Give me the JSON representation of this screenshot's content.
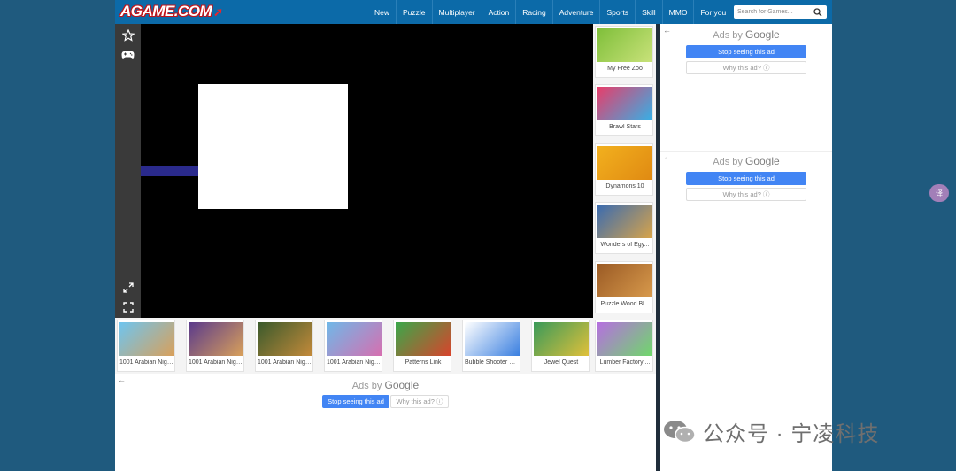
{
  "header": {
    "logo": "AGAME.COM",
    "nav": [
      "New",
      "Puzzle",
      "Multiplayer",
      "Action",
      "Racing",
      "Adventure",
      "Sports",
      "Skill",
      "MMO",
      "For you"
    ],
    "search_placeholder": "Search for Games..."
  },
  "side_games": [
    {
      "label": "My Free Zoo",
      "color1": "#7fbf3a",
      "color2": "#c9e27a"
    },
    {
      "label": "Brawl Stars",
      "color1": "#e83d6a",
      "color2": "#36b0e6"
    },
    {
      "label": "Dynamons 10",
      "color1": "#f2b01e",
      "color2": "#e08a12"
    },
    {
      "label": "Wonders of Egy...",
      "color1": "#3a6bb0",
      "color2": "#d8a44a"
    },
    {
      "label": "Puzzle Wood Bl...",
      "color1": "#9b5b25",
      "color2": "#d89a4c"
    },
    {
      "label": "Lumber Factory ...",
      "color1": "#b66fe0",
      "color2": "#6fd86a"
    }
  ],
  "bottom_games": [
    {
      "label": "1001 Arabian Night...",
      "color1": "#6fc5ef",
      "color2": "#d9a05a"
    },
    {
      "label": "1001 Arabian Night...",
      "color1": "#5a3a8c",
      "color2": "#d9a05a"
    },
    {
      "label": "1001 Arabian Night...",
      "color1": "#3a5a2c",
      "color2": "#c48a3a"
    },
    {
      "label": "1001 Arabian Night...",
      "color1": "#6fb8e8",
      "color2": "#d66fb0"
    },
    {
      "label": "Patterns Link",
      "color1": "#3aa84a",
      "color2": "#d8442c"
    },
    {
      "label": "Bubble Shooter Cl...",
      "color1": "#ffffff",
      "color2": "#3a7fe0"
    },
    {
      "label": "Jewel Quest",
      "color1": "#3a9a5a",
      "color2": "#e0c03a"
    },
    {
      "label": "Lumber Factory ...",
      "color1": "#b66fe0",
      "color2": "#6fd86a"
    }
  ],
  "ads": {
    "ads_by": "Ads by",
    "google": "Google",
    "stop": "Stop seeing this ad",
    "why": "Why this ad? ⓘ"
  },
  "translate": "译",
  "watermark": {
    "text": "公众号 · 宁凌科技"
  },
  "colors": {
    "header": "#0c6aa8",
    "accent": "#4285f4",
    "page_bg": "#1f5a7e"
  }
}
